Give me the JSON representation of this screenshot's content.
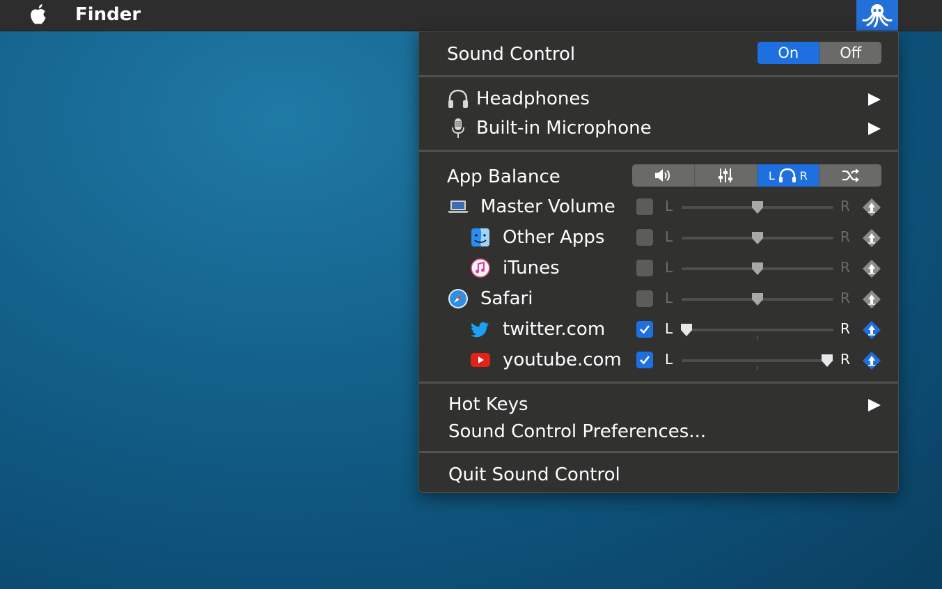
{
  "menubar": {
    "app_name": "Finder",
    "apple_icon": "apple-logo-icon",
    "status_icon": "octopus-icon"
  },
  "menu": {
    "title": "Sound Control",
    "toggle": {
      "on_label": "On",
      "off_label": "Off",
      "selected": "On"
    },
    "devices": [
      {
        "icon": "headphones-icon",
        "label": "Headphones"
      },
      {
        "icon": "microphone-icon",
        "label": "Built-in Microphone"
      }
    ],
    "app_balance": {
      "label": "App Balance",
      "modes": [
        {
          "icon": "speaker-volume-icon",
          "label": ""
        },
        {
          "icon": "equalizer-sliders-icon",
          "label": ""
        },
        {
          "icon": "headphones-balance-icon",
          "label_left": "L",
          "label_right": "R",
          "active": true
        },
        {
          "icon": "shuffle-icon",
          "label": ""
        }
      ],
      "rows": [
        {
          "name": "Master Volume",
          "icon": "laptop-icon",
          "indent": 0,
          "enabled": false,
          "left": "L",
          "right": "R",
          "balance": 0.5
        },
        {
          "name": "Other Apps",
          "icon": "finder-icon",
          "indent": 1,
          "enabled": false,
          "left": "L",
          "right": "R",
          "balance": 0.5
        },
        {
          "name": "iTunes",
          "icon": "itunes-icon",
          "indent": 1,
          "enabled": false,
          "left": "L",
          "right": "R",
          "balance": 0.5
        },
        {
          "name": "Safari",
          "icon": "safari-compass-icon",
          "indent": 0,
          "enabled": false,
          "left": "L",
          "right": "R",
          "balance": 0.5
        },
        {
          "name": "twitter.com",
          "icon": "twitter-bird-icon",
          "indent": 1,
          "enabled": true,
          "left": "L",
          "right": "R",
          "balance": 0.03
        },
        {
          "name": "youtube.com",
          "icon": "youtube-play-icon",
          "indent": 1,
          "enabled": true,
          "left": "L",
          "right": "R",
          "balance": 0.96
        }
      ]
    },
    "hot_keys": "Hot Keys",
    "preferences": "Sound Control Preferences...",
    "quit": "Quit Sound Control"
  },
  "colors": {
    "accent": "#1e6fe0",
    "menu_bg": "#313130",
    "menubar_bg": "#2d2d2d",
    "twitter": "#1da1f2",
    "youtube": "#e62117"
  }
}
